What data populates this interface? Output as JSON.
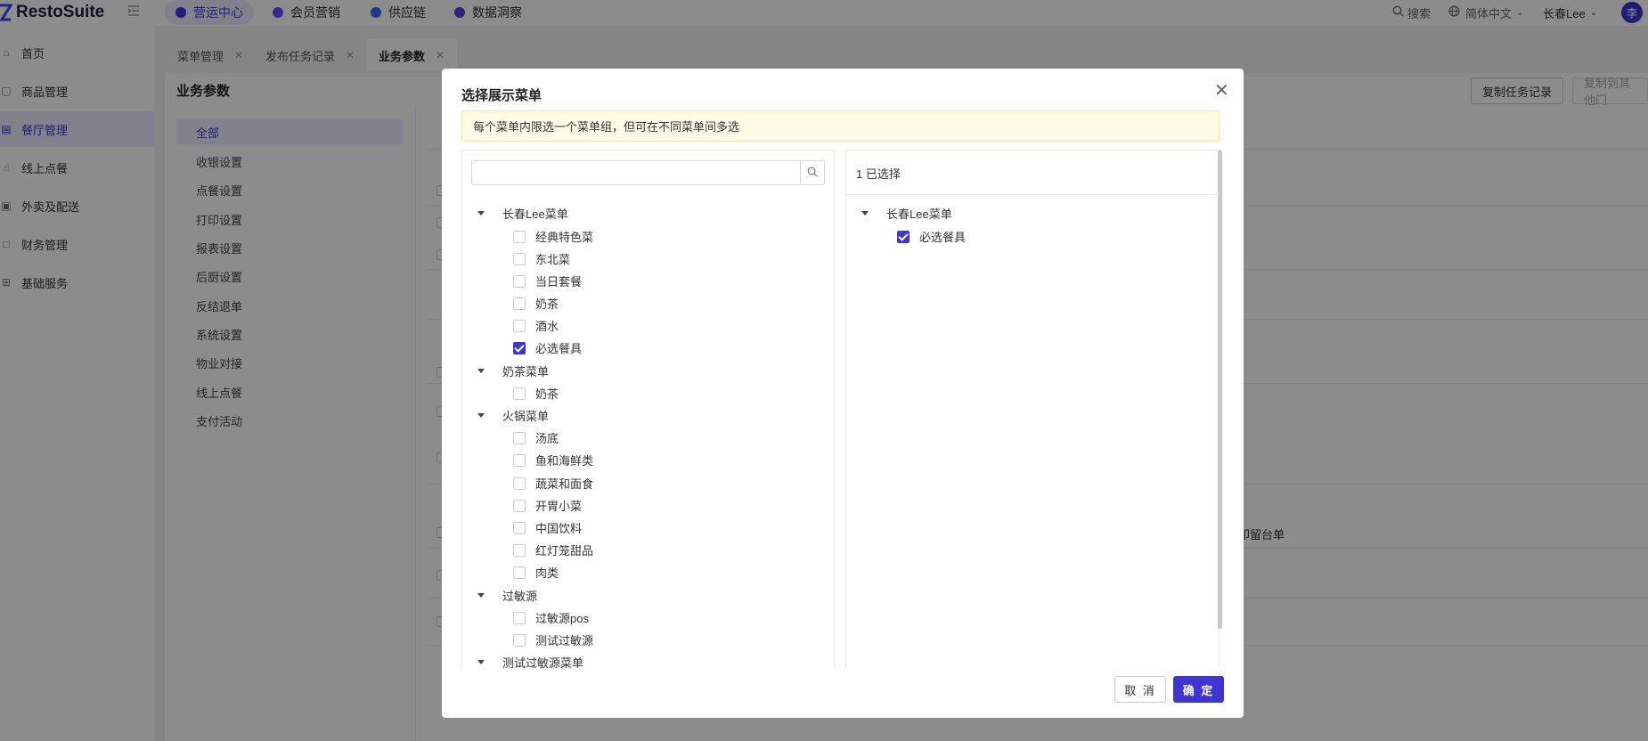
{
  "app": {
    "name": "RestoSuite"
  },
  "topnav": {
    "tabs": [
      {
        "label": "营运中心",
        "active": true,
        "color": "#3d35d6"
      },
      {
        "label": "会员营销",
        "active": false,
        "color": "#6a4cff"
      },
      {
        "label": "供应链",
        "active": false,
        "color": "#2f6bff"
      },
      {
        "label": "数据洞察",
        "active": false,
        "color": "#5a3ce0"
      }
    ],
    "search_label": "搜索",
    "language": "简体中文",
    "user": "长春Lee",
    "avatar_initial": "李"
  },
  "sidebar": {
    "items": [
      {
        "label": "首页",
        "icon": "home-icon",
        "active": false
      },
      {
        "label": "商品管理",
        "icon": "cube-icon",
        "active": false
      },
      {
        "label": "餐厅管理",
        "icon": "store-icon",
        "active": true
      },
      {
        "label": "线上点餐",
        "icon": "hand-icon",
        "active": false
      },
      {
        "label": "外卖及配送",
        "icon": "bag-icon",
        "active": false
      },
      {
        "label": "财务管理",
        "icon": "folder-icon",
        "active": false
      },
      {
        "label": "基础服务",
        "icon": "grid-icon",
        "active": false
      }
    ]
  },
  "page_tabs": [
    {
      "label": "菜单管理",
      "active": false
    },
    {
      "label": "发布任务记录",
      "active": false
    },
    {
      "label": "业务参数",
      "active": true
    }
  ],
  "content": {
    "title": "业务参数",
    "copy_task_button": "复制任务记录",
    "copy_to_other_button": "复制到其他门",
    "categories": [
      "全部",
      "收银设置",
      "点餐设置",
      "打印设置",
      "报表设置",
      "后厨设置",
      "反结退单",
      "系统设置",
      "物业对接",
      "线上点餐",
      "支付活动"
    ],
    "partial_text": "印留台单"
  },
  "modal": {
    "title": "选择展示菜单",
    "notice": "每个菜单内限选一个菜单组，但可在不同菜单间多选",
    "search_value": "",
    "selected_count_label": "1 已选择",
    "left_tree": [
      {
        "label": "长春Lee菜单",
        "children": [
          {
            "label": "经典特色菜",
            "checked": false
          },
          {
            "label": "东北菜",
            "checked": false
          },
          {
            "label": "当日套餐",
            "checked": false
          },
          {
            "label": "奶茶",
            "checked": false
          },
          {
            "label": "酒水",
            "checked": false
          },
          {
            "label": "必选餐具",
            "checked": true
          }
        ]
      },
      {
        "label": "奶茶菜单",
        "children": [
          {
            "label": "奶茶",
            "checked": false
          }
        ]
      },
      {
        "label": "火锅菜单",
        "children": [
          {
            "label": "汤底",
            "checked": false
          },
          {
            "label": "鱼和海鲜类",
            "checked": false
          },
          {
            "label": "蔬菜和面食",
            "checked": false
          },
          {
            "label": "开胃小菜",
            "checked": false
          },
          {
            "label": "中国饮料",
            "checked": false
          },
          {
            "label": "红灯笼甜品",
            "checked": false
          },
          {
            "label": "肉类",
            "checked": false
          }
        ]
      },
      {
        "label": "过敏源",
        "children": [
          {
            "label": "过敏源pos",
            "checked": false
          },
          {
            "label": "测试过敏源",
            "checked": false
          }
        ]
      },
      {
        "label": "测试过敏源菜单",
        "children": []
      }
    ],
    "right_tree": [
      {
        "label": "长春Lee菜单",
        "children": [
          {
            "label": "必选餐具",
            "checked": true
          }
        ]
      }
    ],
    "cancel_label": "取 消",
    "ok_label": "确 定"
  }
}
